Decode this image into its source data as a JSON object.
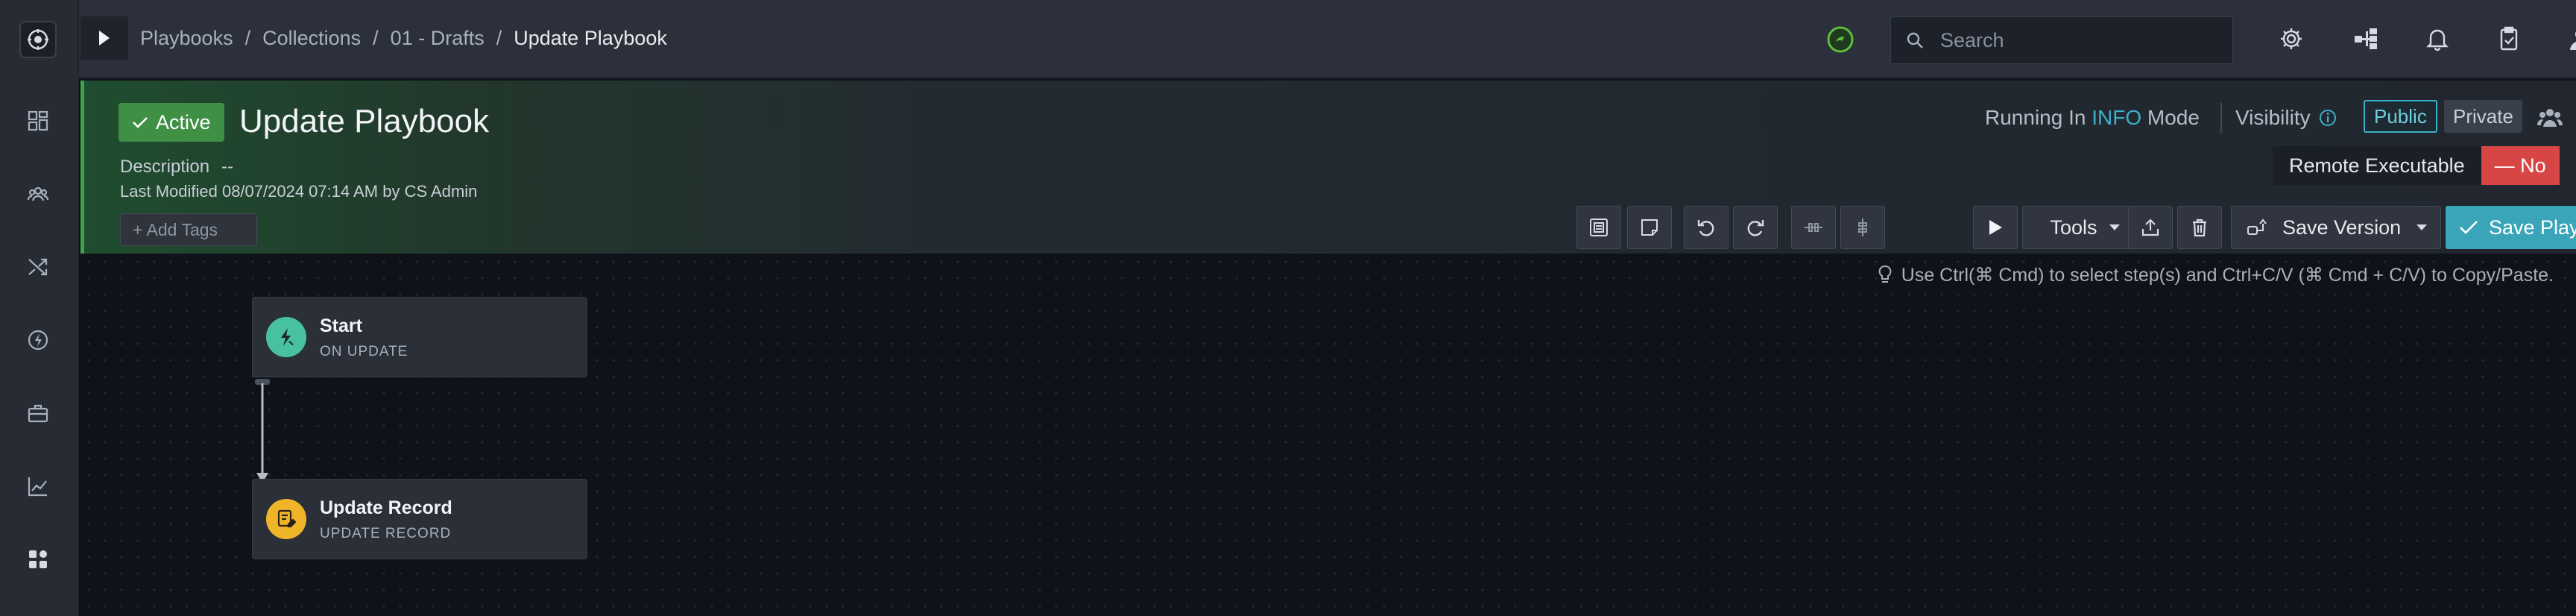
{
  "breadcrumbs": {
    "items": [
      "Playbooks",
      "Collections",
      "01 - Drafts"
    ],
    "separator": "/",
    "current": "Update Playbook"
  },
  "search": {
    "placeholder": "Search"
  },
  "playbook": {
    "status": "Active",
    "title": "Update Playbook",
    "description_label": "Description",
    "description_value": "--",
    "last_modified": "Last Modified 08/07/2024 07:14 AM by CS Admin",
    "add_tags": "+ Add Tags"
  },
  "mode": {
    "prefix": "Running In",
    "level": "INFO",
    "suffix": "Mode"
  },
  "visibility": {
    "label": "Visibility",
    "public": "Public",
    "private": "Private",
    "selected": "Public"
  },
  "remote_executable": {
    "label": "Remote Executable",
    "value": "— No"
  },
  "toolbar": {
    "tools_label": "Tools",
    "save_version_label": "Save Version",
    "save_playbook_label": "Save Playbook"
  },
  "canvas": {
    "hint": "Use Ctrl(⌘ Cmd) to select step(s) and Ctrl+C/V (⌘ Cmd + C/V) to Copy/Paste.",
    "nodes": [
      {
        "title": "Start",
        "subtitle": "ON UPDATE"
      },
      {
        "title": "Update Record",
        "subtitle": "UPDATE RECORD"
      }
    ]
  },
  "colors": {
    "active": "#3f8f45",
    "accent": "#3aa5b9",
    "danger": "#d84545",
    "start_node": "#48c1a0",
    "update_node": "#f0b429"
  },
  "icons": {
    "rail": [
      "dashboard-icon",
      "people-icon",
      "shuffle-icon",
      "lightning-icon",
      "briefcase-icon",
      "chart-icon",
      "apps-icon"
    ],
    "topbar": [
      "settings-icon",
      "hierarchy-icon",
      "bell-icon",
      "clipboard-icon",
      "user-icon"
    ],
    "toolbar": [
      "doc-view-icon",
      "note-icon",
      "undo-icon",
      "redo-icon",
      "align-horizontal-icon",
      "align-vertical-icon",
      "play-icon",
      "export-icon",
      "trash-icon",
      "version-icon",
      "check-icon"
    ]
  }
}
